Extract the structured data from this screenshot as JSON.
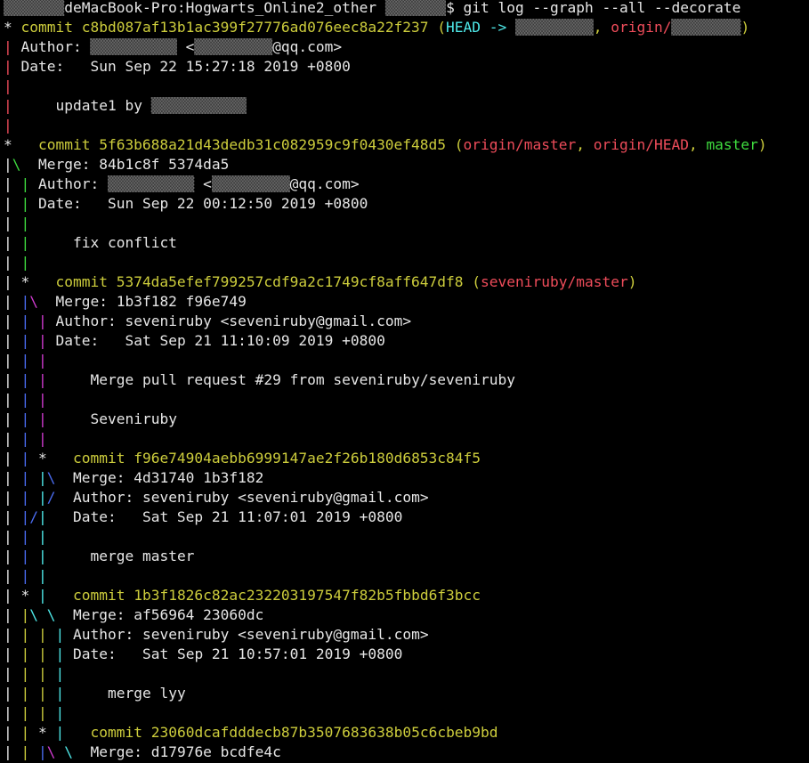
{
  "terminal": {
    "colors": {
      "background": "#000000",
      "text": "#e6e6e6",
      "yellow": "#cdcd3c",
      "cyan": "#4ee8e8",
      "red": "#ee4c5a",
      "green": "#3fdc3f",
      "blue": "#4a6cf0",
      "magenta": "#d13bd1"
    },
    "lines": [
      {
        "segs": [
          {
            "t": "▒▒▒▒▒▒▒",
            "c": "redact"
          },
          {
            "t": "deMacBook-Pro:Hogwarts_Online2_other ",
            "c": "norm"
          },
          {
            "t": "▒▒▒▒▒▒▒",
            "c": "redact"
          },
          {
            "t": "$ git log --graph --all --decorate",
            "c": "norm"
          }
        ]
      },
      {
        "segs": [
          {
            "t": "* ",
            "c": "norm"
          },
          {
            "t": "commit c8bd087af13b1ac399f27776ad076eec8a22f237 (",
            "c": "yellow"
          },
          {
            "t": "HEAD -> ",
            "c": "cyan"
          },
          {
            "t": "▒▒▒▒▒▒▒▒▒",
            "c": "redact"
          },
          {
            "t": ", ",
            "c": "yellow"
          },
          {
            "t": "origin/",
            "c": "red"
          },
          {
            "t": "▒▒▒▒▒▒▒▒",
            "c": "redact"
          },
          {
            "t": ")",
            "c": "yellow"
          }
        ]
      },
      {
        "segs": [
          {
            "t": "| ",
            "c": "red"
          },
          {
            "t": "Author: ",
            "c": "norm"
          },
          {
            "t": "▒▒▒▒▒▒▒▒▒▒",
            "c": "redact"
          },
          {
            "t": " <",
            "c": "norm"
          },
          {
            "t": "▒▒▒▒▒▒▒▒▒",
            "c": "redact"
          },
          {
            "t": "@qq.com>",
            "c": "norm"
          }
        ]
      },
      {
        "segs": [
          {
            "t": "| ",
            "c": "red"
          },
          {
            "t": "Date:   Sun Sep 22 15:27:18 2019 +0800",
            "c": "norm"
          }
        ]
      },
      {
        "segs": [
          {
            "t": "|",
            "c": "red"
          }
        ]
      },
      {
        "segs": [
          {
            "t": "| ",
            "c": "red"
          },
          {
            "t": "    update1 by ",
            "c": "norm"
          },
          {
            "t": "▒▒▒▒▒▒▒▒▒▒▒",
            "c": "redact"
          }
        ]
      },
      {
        "segs": [
          {
            "t": "|",
            "c": "red"
          }
        ]
      },
      {
        "segs": [
          {
            "t": "*   ",
            "c": "norm"
          },
          {
            "t": "commit 5f63b688a21d43dedb31c082959c9f0430ef48d5 (",
            "c": "yellow"
          },
          {
            "t": "origin/master",
            "c": "red"
          },
          {
            "t": ", ",
            "c": "yellow"
          },
          {
            "t": "origin/HEAD",
            "c": "red"
          },
          {
            "t": ", ",
            "c": "yellow"
          },
          {
            "t": "master",
            "c": "green"
          },
          {
            "t": ")",
            "c": "yellow"
          }
        ]
      },
      {
        "segs": [
          {
            "t": "|",
            "c": "norm"
          },
          {
            "t": "\\",
            "c": "green"
          },
          {
            "t": "  Merge: 84b1c8f 5374da5",
            "c": "norm"
          }
        ]
      },
      {
        "segs": [
          {
            "t": "| ",
            "c": "norm"
          },
          {
            "t": "| ",
            "c": "green"
          },
          {
            "t": "Author: ",
            "c": "norm"
          },
          {
            "t": "▒▒▒▒▒▒▒▒▒▒",
            "c": "redact"
          },
          {
            "t": " <",
            "c": "norm"
          },
          {
            "t": "▒▒▒▒▒▒▒▒▒",
            "c": "redact"
          },
          {
            "t": "@qq.com>",
            "c": "norm"
          }
        ]
      },
      {
        "segs": [
          {
            "t": "| ",
            "c": "norm"
          },
          {
            "t": "| ",
            "c": "green"
          },
          {
            "t": "Date:   Sun Sep 22 00:12:50 2019 +0800",
            "c": "norm"
          }
        ]
      },
      {
        "segs": [
          {
            "t": "| ",
            "c": "norm"
          },
          {
            "t": "|",
            "c": "green"
          }
        ]
      },
      {
        "segs": [
          {
            "t": "| ",
            "c": "norm"
          },
          {
            "t": "| ",
            "c": "green"
          },
          {
            "t": "    fix conflict",
            "c": "norm"
          }
        ]
      },
      {
        "segs": [
          {
            "t": "| ",
            "c": "norm"
          },
          {
            "t": "|",
            "c": "green"
          }
        ]
      },
      {
        "segs": [
          {
            "t": "| ",
            "c": "norm"
          },
          {
            "t": "*   ",
            "c": "norm"
          },
          {
            "t": "commit 5374da5efef799257cdf9a2c1749cf8aff647df8 (",
            "c": "yellow"
          },
          {
            "t": "seveniruby/master",
            "c": "red"
          },
          {
            "t": ")",
            "c": "yellow"
          }
        ]
      },
      {
        "segs": [
          {
            "t": "| ",
            "c": "norm"
          },
          {
            "t": "|",
            "c": "blue"
          },
          {
            "t": "\\",
            "c": "magenta"
          },
          {
            "t": "  Merge: 1b3f182 f96e749",
            "c": "norm"
          }
        ]
      },
      {
        "segs": [
          {
            "t": "| ",
            "c": "norm"
          },
          {
            "t": "| ",
            "c": "blue"
          },
          {
            "t": "| ",
            "c": "magenta"
          },
          {
            "t": "Author: seveniruby <seveniruby@gmail.com>",
            "c": "norm"
          }
        ]
      },
      {
        "segs": [
          {
            "t": "| ",
            "c": "norm"
          },
          {
            "t": "| ",
            "c": "blue"
          },
          {
            "t": "| ",
            "c": "magenta"
          },
          {
            "t": "Date:   Sat Sep 21 11:10:09 2019 +0800",
            "c": "norm"
          }
        ]
      },
      {
        "segs": [
          {
            "t": "| ",
            "c": "norm"
          },
          {
            "t": "| ",
            "c": "blue"
          },
          {
            "t": "|",
            "c": "magenta"
          }
        ]
      },
      {
        "segs": [
          {
            "t": "| ",
            "c": "norm"
          },
          {
            "t": "| ",
            "c": "blue"
          },
          {
            "t": "| ",
            "c": "magenta"
          },
          {
            "t": "    Merge pull request #29 from seveniruby/seveniruby",
            "c": "norm"
          }
        ]
      },
      {
        "segs": [
          {
            "t": "| ",
            "c": "norm"
          },
          {
            "t": "| ",
            "c": "blue"
          },
          {
            "t": "|",
            "c": "magenta"
          }
        ]
      },
      {
        "segs": [
          {
            "t": "| ",
            "c": "norm"
          },
          {
            "t": "| ",
            "c": "blue"
          },
          {
            "t": "| ",
            "c": "magenta"
          },
          {
            "t": "    Seveniruby",
            "c": "norm"
          }
        ]
      },
      {
        "segs": [
          {
            "t": "| ",
            "c": "norm"
          },
          {
            "t": "| ",
            "c": "blue"
          },
          {
            "t": "|",
            "c": "magenta"
          }
        ]
      },
      {
        "segs": [
          {
            "t": "| ",
            "c": "norm"
          },
          {
            "t": "| ",
            "c": "blue"
          },
          {
            "t": "*   ",
            "c": "norm"
          },
          {
            "t": "commit f96e74904aebb6999147ae2f26b180d6853c84f5",
            "c": "yellow"
          }
        ]
      },
      {
        "segs": [
          {
            "t": "| ",
            "c": "norm"
          },
          {
            "t": "| ",
            "c": "blue"
          },
          {
            "t": "|",
            "c": "cyan"
          },
          {
            "t": "\\",
            "c": "blue"
          },
          {
            "t": "  Merge: 4d31740 1b3f182",
            "c": "norm"
          }
        ]
      },
      {
        "segs": [
          {
            "t": "| ",
            "c": "norm"
          },
          {
            "t": "| ",
            "c": "blue"
          },
          {
            "t": "|",
            "c": "cyan"
          },
          {
            "t": "/",
            "c": "blue"
          },
          {
            "t": "  Author: seveniruby <seveniruby@gmail.com>",
            "c": "norm"
          }
        ]
      },
      {
        "segs": [
          {
            "t": "| ",
            "c": "norm"
          },
          {
            "t": "|",
            "c": "blue"
          },
          {
            "t": "/",
            "c": "blue"
          },
          {
            "t": "|",
            "c": "cyan"
          },
          {
            "t": "   Date:   Sat Sep 21 11:07:01 2019 +0800",
            "c": "norm"
          }
        ]
      },
      {
        "segs": [
          {
            "t": "| ",
            "c": "norm"
          },
          {
            "t": "| ",
            "c": "blue"
          },
          {
            "t": "|",
            "c": "cyan"
          }
        ]
      },
      {
        "segs": [
          {
            "t": "| ",
            "c": "norm"
          },
          {
            "t": "| ",
            "c": "blue"
          },
          {
            "t": "| ",
            "c": "cyan"
          },
          {
            "t": "    merge master",
            "c": "norm"
          }
        ]
      },
      {
        "segs": [
          {
            "t": "| ",
            "c": "norm"
          },
          {
            "t": "| ",
            "c": "blue"
          },
          {
            "t": "|",
            "c": "cyan"
          }
        ]
      },
      {
        "segs": [
          {
            "t": "| ",
            "c": "norm"
          },
          {
            "t": "* ",
            "c": "norm"
          },
          {
            "t": "| ",
            "c": "cyan"
          },
          {
            "t": "  commit 1b3f1826c82ac232203197547f82b5fbbd6f3bcc",
            "c": "yellow"
          }
        ]
      },
      {
        "segs": [
          {
            "t": "| ",
            "c": "norm"
          },
          {
            "t": "|",
            "c": "yellow"
          },
          {
            "t": "\\",
            "c": "cyan"
          },
          {
            "t": " ",
            "c": "norm"
          },
          {
            "t": "\\",
            "c": "cyan"
          },
          {
            "t": "  Merge: af56964 23060dc",
            "c": "norm"
          }
        ]
      },
      {
        "segs": [
          {
            "t": "| ",
            "c": "norm"
          },
          {
            "t": "| ",
            "c": "yellow"
          },
          {
            "t": "| ",
            "c": "yellow"
          },
          {
            "t": "| ",
            "c": "cyan"
          },
          {
            "t": "Author: seveniruby <seveniruby@gmail.com>",
            "c": "norm"
          }
        ]
      },
      {
        "segs": [
          {
            "t": "| ",
            "c": "norm"
          },
          {
            "t": "| ",
            "c": "yellow"
          },
          {
            "t": "| ",
            "c": "yellow"
          },
          {
            "t": "| ",
            "c": "cyan"
          },
          {
            "t": "Date:   Sat Sep 21 10:57:01 2019 +0800",
            "c": "norm"
          }
        ]
      },
      {
        "segs": [
          {
            "t": "| ",
            "c": "norm"
          },
          {
            "t": "| ",
            "c": "yellow"
          },
          {
            "t": "| ",
            "c": "yellow"
          },
          {
            "t": "|",
            "c": "cyan"
          }
        ]
      },
      {
        "segs": [
          {
            "t": "| ",
            "c": "norm"
          },
          {
            "t": "| ",
            "c": "yellow"
          },
          {
            "t": "| ",
            "c": "yellow"
          },
          {
            "t": "| ",
            "c": "cyan"
          },
          {
            "t": "    merge lyy",
            "c": "norm"
          }
        ]
      },
      {
        "segs": [
          {
            "t": "| ",
            "c": "norm"
          },
          {
            "t": "| ",
            "c": "yellow"
          },
          {
            "t": "| ",
            "c": "yellow"
          },
          {
            "t": "|",
            "c": "cyan"
          }
        ]
      },
      {
        "segs": [
          {
            "t": "| ",
            "c": "norm"
          },
          {
            "t": "| ",
            "c": "yellow"
          },
          {
            "t": "* ",
            "c": "norm"
          },
          {
            "t": "| ",
            "c": "cyan"
          },
          {
            "t": "  commit 23060dcafdddecb87b3507683638b05c6cbeb9bd",
            "c": "yellow"
          }
        ]
      },
      {
        "segs": [
          {
            "t": "| ",
            "c": "norm"
          },
          {
            "t": "| ",
            "c": "yellow"
          },
          {
            "t": "|",
            "c": "blue"
          },
          {
            "t": "\\",
            "c": "magenta"
          },
          {
            "t": " ",
            "c": "norm"
          },
          {
            "t": "\\",
            "c": "cyan"
          },
          {
            "t": "  Merge: d17976e bcdfe4c",
            "c": "norm"
          }
        ]
      }
    ]
  }
}
